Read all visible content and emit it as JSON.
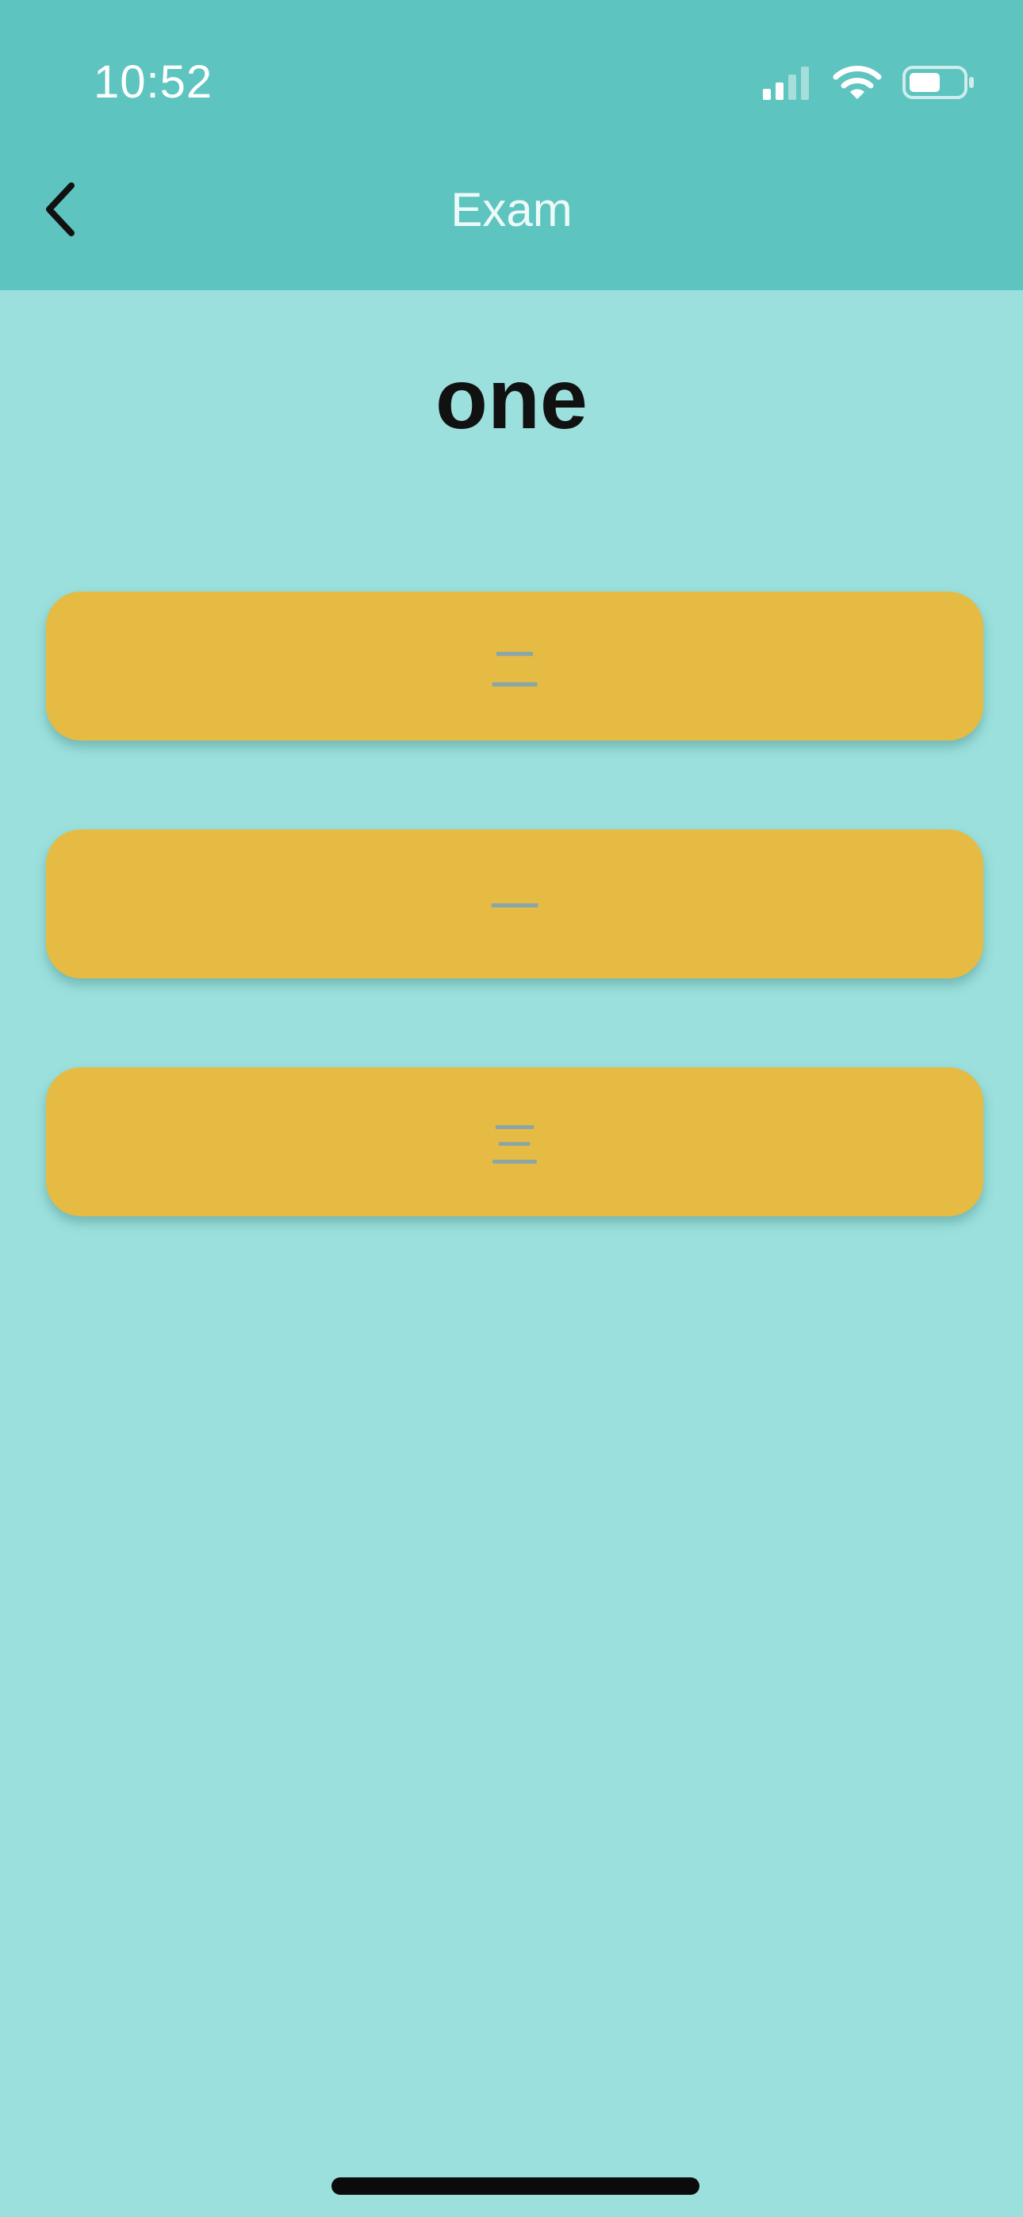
{
  "status_bar": {
    "time": "10:52",
    "icons": [
      "cellular-signal-icon",
      "wifi-icon",
      "battery-icon"
    ]
  },
  "nav": {
    "back_icon": "chevron-left-icon",
    "title": "Exam"
  },
  "question": {
    "word": "one"
  },
  "options": [
    {
      "label": "二"
    },
    {
      "label": "一"
    },
    {
      "label": "三"
    }
  ],
  "colors": {
    "header": "#5dc4bf",
    "background": "#9be0dc",
    "option": "#e6bb43",
    "option_text": "#8aa6a6"
  }
}
